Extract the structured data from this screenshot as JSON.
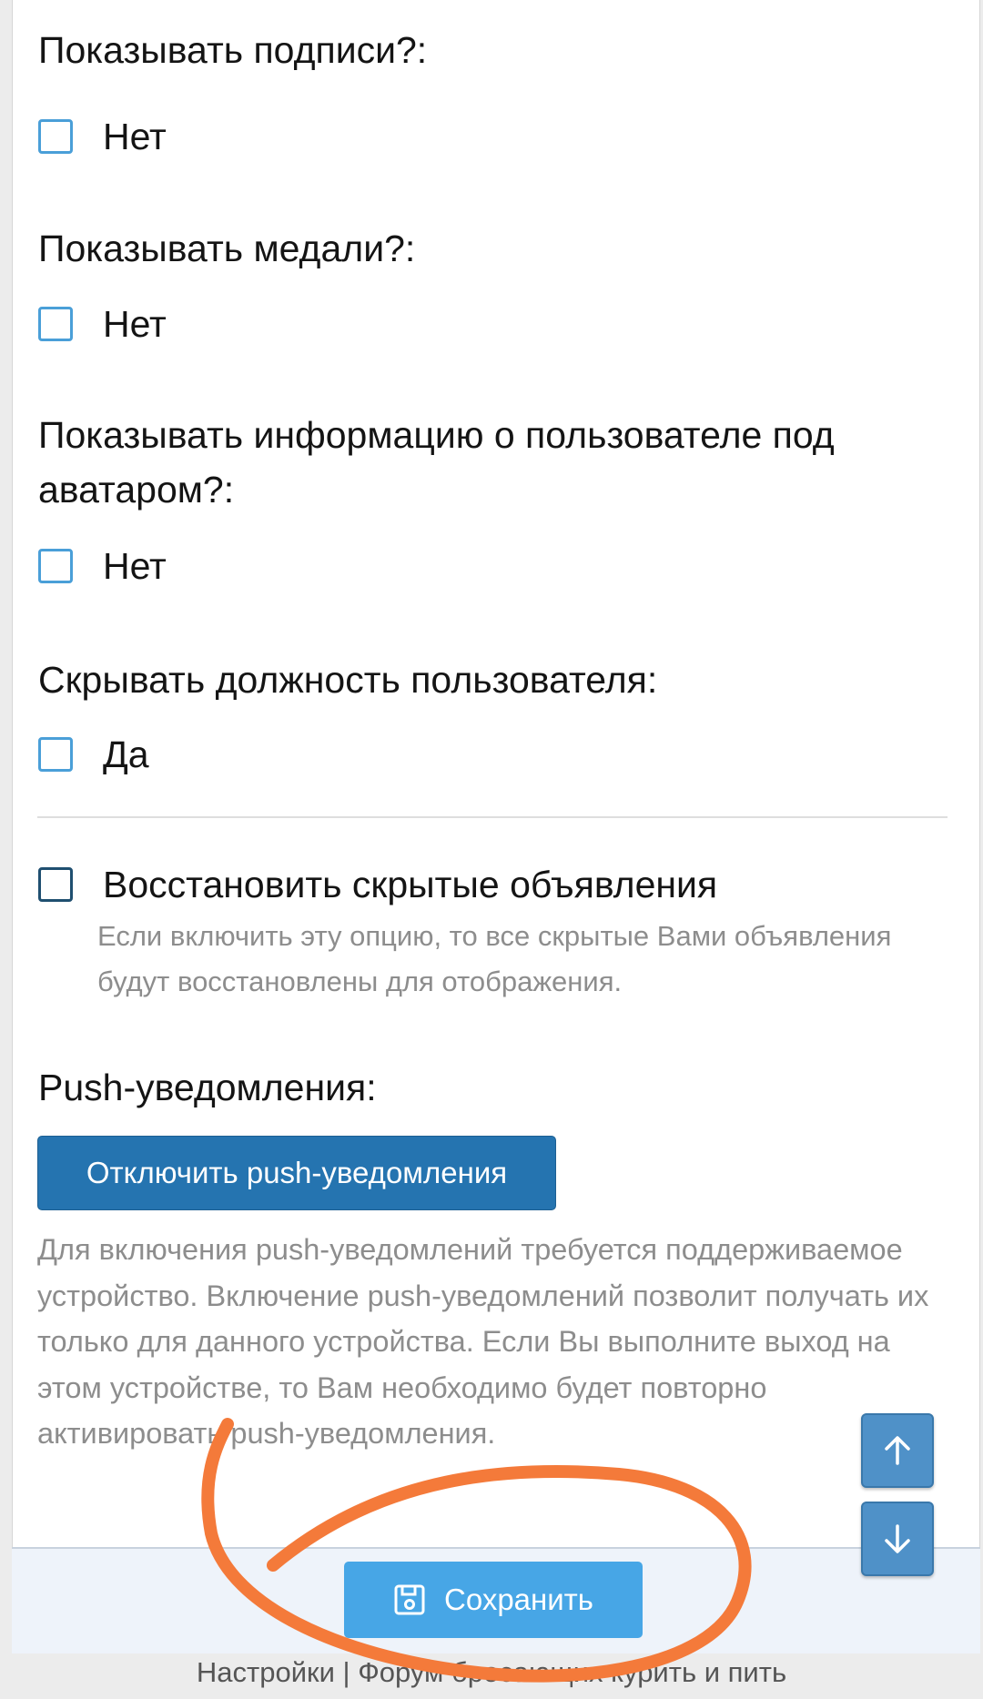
{
  "settings": {
    "signatures": {
      "question": "Показывать подписи?:",
      "option": "Нет"
    },
    "medals": {
      "question": "Показывать медали?:",
      "option": "Нет"
    },
    "user_info": {
      "question": "Показывать информацию о пользователе под аватаром?:",
      "option": "Нет"
    },
    "hide_title": {
      "question": "Скрывать должность пользователя:",
      "option": "Да"
    }
  },
  "restore_notices": {
    "label": "Восстановить скрытые объявления",
    "hint": "Если включить эту опцию, то все скрытые Вами объявления будут восстановлены для отображения."
  },
  "push": {
    "heading": "Push-уведомления:",
    "button_label": "Отключить push-уведомления",
    "description": "Для включения push-уведомлений требуется поддерживаемое устройство. Включение push-уведомлений позволит получать их только для данного устройства. Если Вы выполните выход на этом устройстве, то Вам необходимо будет повторно активировать push-уведомления."
  },
  "footer": {
    "save_label": "Сохранить",
    "breadcrumb": "Настройки | Форум бросающих курить и пить"
  },
  "icons": {
    "save": "floppy-disk-icon",
    "scroll_up": "arrow-up-icon",
    "scroll_down": "arrow-down-icon"
  },
  "colors": {
    "accent": "#2574b0",
    "save_button": "#47a6e6",
    "checkbox_border": "#4a9fd8",
    "annotation": "#f47a3a"
  }
}
